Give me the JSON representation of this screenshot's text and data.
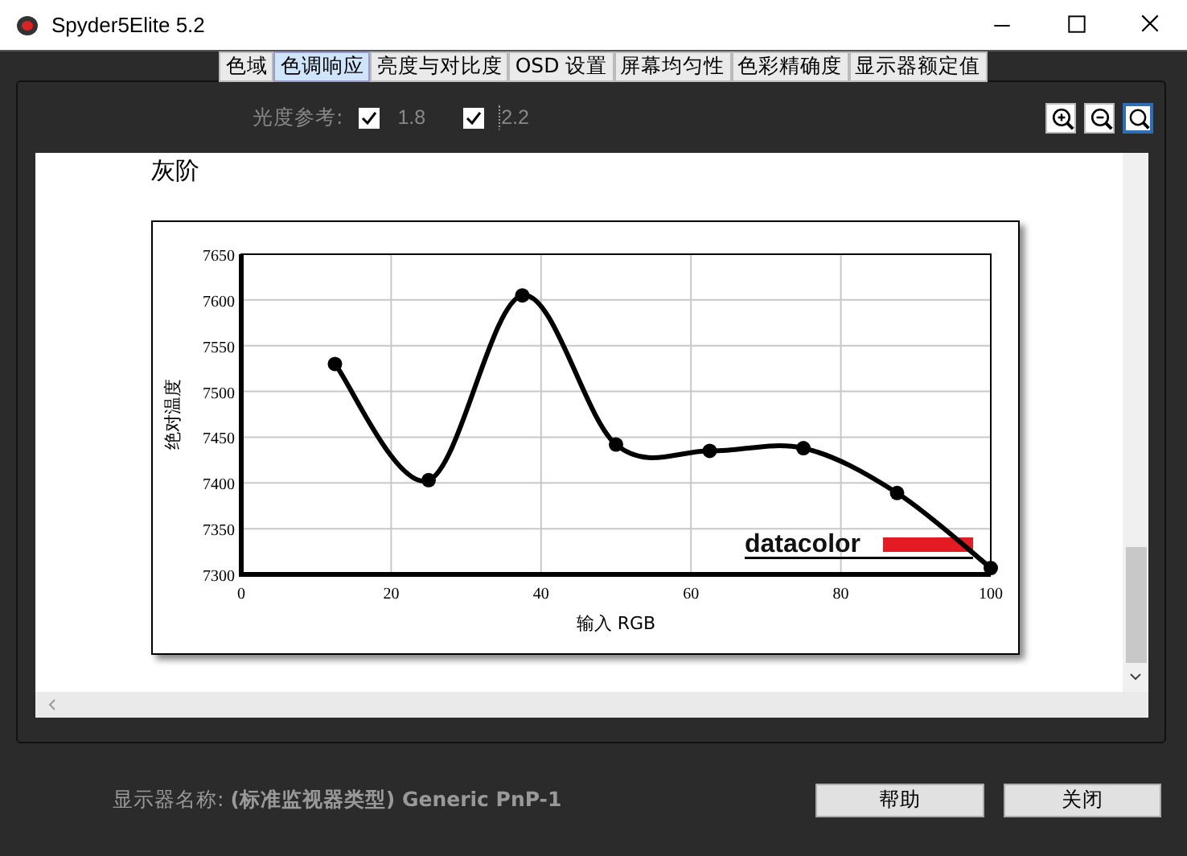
{
  "window": {
    "title": "Spyder5Elite 5.2"
  },
  "tabs": [
    {
      "label": "色域",
      "selected": false
    },
    {
      "label": "色调响应",
      "selected": true
    },
    {
      "label": "亮度与对比度",
      "selected": false
    },
    {
      "label": "OSD 设置",
      "selected": false
    },
    {
      "label": "屏幕均匀性",
      "selected": false
    },
    {
      "label": "色彩精确度",
      "selected": false
    },
    {
      "label": "显示器额定值",
      "selected": false
    }
  ],
  "reference": {
    "label": "光度参考:",
    "options": [
      {
        "label": "1.8",
        "checked": true,
        "focused": false
      },
      {
        "label": "2.2",
        "checked": true,
        "focused": true
      }
    ]
  },
  "zoom_tools": [
    {
      "kind": "zoom-in",
      "selected": false
    },
    {
      "kind": "zoom-out",
      "selected": false
    },
    {
      "kind": "zoom-fit",
      "selected": true
    }
  ],
  "section_title": "灰阶",
  "chart": {
    "logo": "datacolor",
    "chart_data": {
      "type": "line",
      "xlabel": "输入  RGB",
      "ylabel": "绝对温度",
      "x": [
        12.5,
        25,
        37.5,
        50,
        62.5,
        75,
        87.5,
        100
      ],
      "grid": true,
      "series": [
        {
          "color": "#000000",
          "marker": "circle",
          "values": [
            7530,
            7403,
            7605,
            7442,
            7435,
            7438,
            7389,
            7307
          ]
        }
      ],
      "xlim": [
        0,
        100
      ],
      "ylim": [
        7300,
        7650
      ],
      "xticks": [
        0,
        20,
        40,
        60,
        80,
        100
      ],
      "yticks": [
        7300,
        7350,
        7400,
        7450,
        7500,
        7550,
        7600,
        7650
      ]
    }
  },
  "status": {
    "label": "显示器名称:",
    "value": "(标准监视器类型) Generic PnP-1"
  },
  "buttons": [
    "帮助",
    "关闭"
  ]
}
